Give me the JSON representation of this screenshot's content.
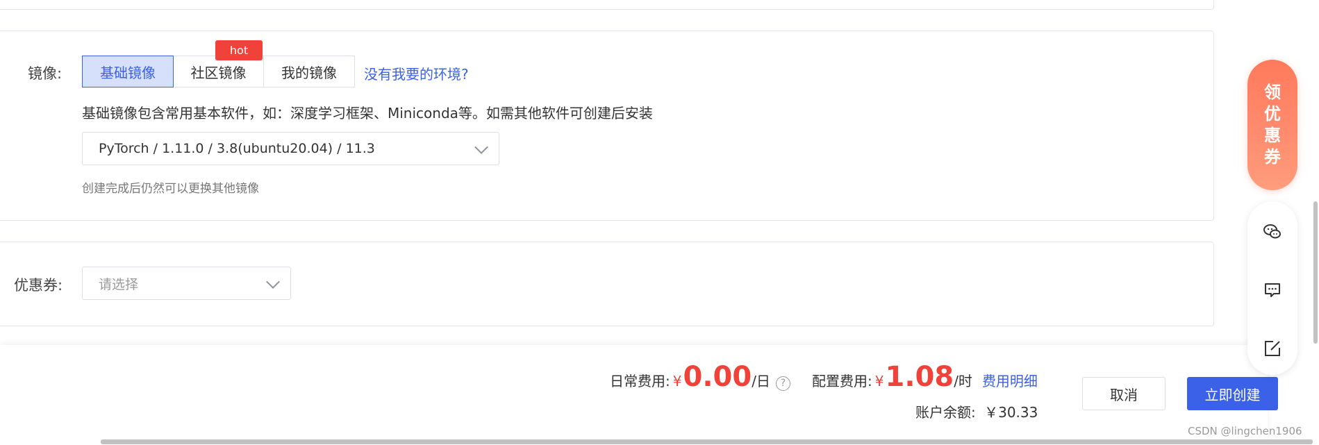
{
  "image_section": {
    "label": "镜像:",
    "tabs": [
      {
        "label": "基础镜像",
        "active": true
      },
      {
        "label": "社区镜像",
        "active": false
      },
      {
        "label": "我的镜像",
        "active": false
      }
    ],
    "hot_badge": "hot",
    "missing_env_link": "没有我要的环境?",
    "description": "基础镜像包含常用基本软件，如：深度学习框架、Miniconda等。如需其他软件可创建后安装",
    "selected_image": "PyTorch / 1.11.0 / 3.8(ubuntu20.04) / 11.3",
    "hint": "创建完成后仍然可以更换其他镜像"
  },
  "coupon_section": {
    "label": "优惠券:",
    "placeholder": "请选择"
  },
  "footer": {
    "daily_label": "日常费用:",
    "daily_currency": "¥",
    "daily_value": "0.00",
    "daily_unit": "/日",
    "help_icon": "?",
    "config_label": "配置费用:",
    "config_currency": "¥",
    "config_value": "1.08",
    "config_unit": "/时",
    "fee_detail_link": "费用明细",
    "balance_label": "账户余额:",
    "balance_value": "￥30.33",
    "cancel_label": "取消",
    "create_label": "立即创建"
  },
  "sidebar": {
    "coupon_text": [
      "领",
      "优",
      "惠",
      "券"
    ],
    "icons": [
      "wechat-icon",
      "message-icon",
      "edit-icon"
    ]
  },
  "watermark": "CSDN @lingchen1906",
  "colors": {
    "accent": "#3a61e8",
    "price_red": "#f04238",
    "hot_red": "#f04238",
    "coupon_orange": "#ff8b6e"
  }
}
